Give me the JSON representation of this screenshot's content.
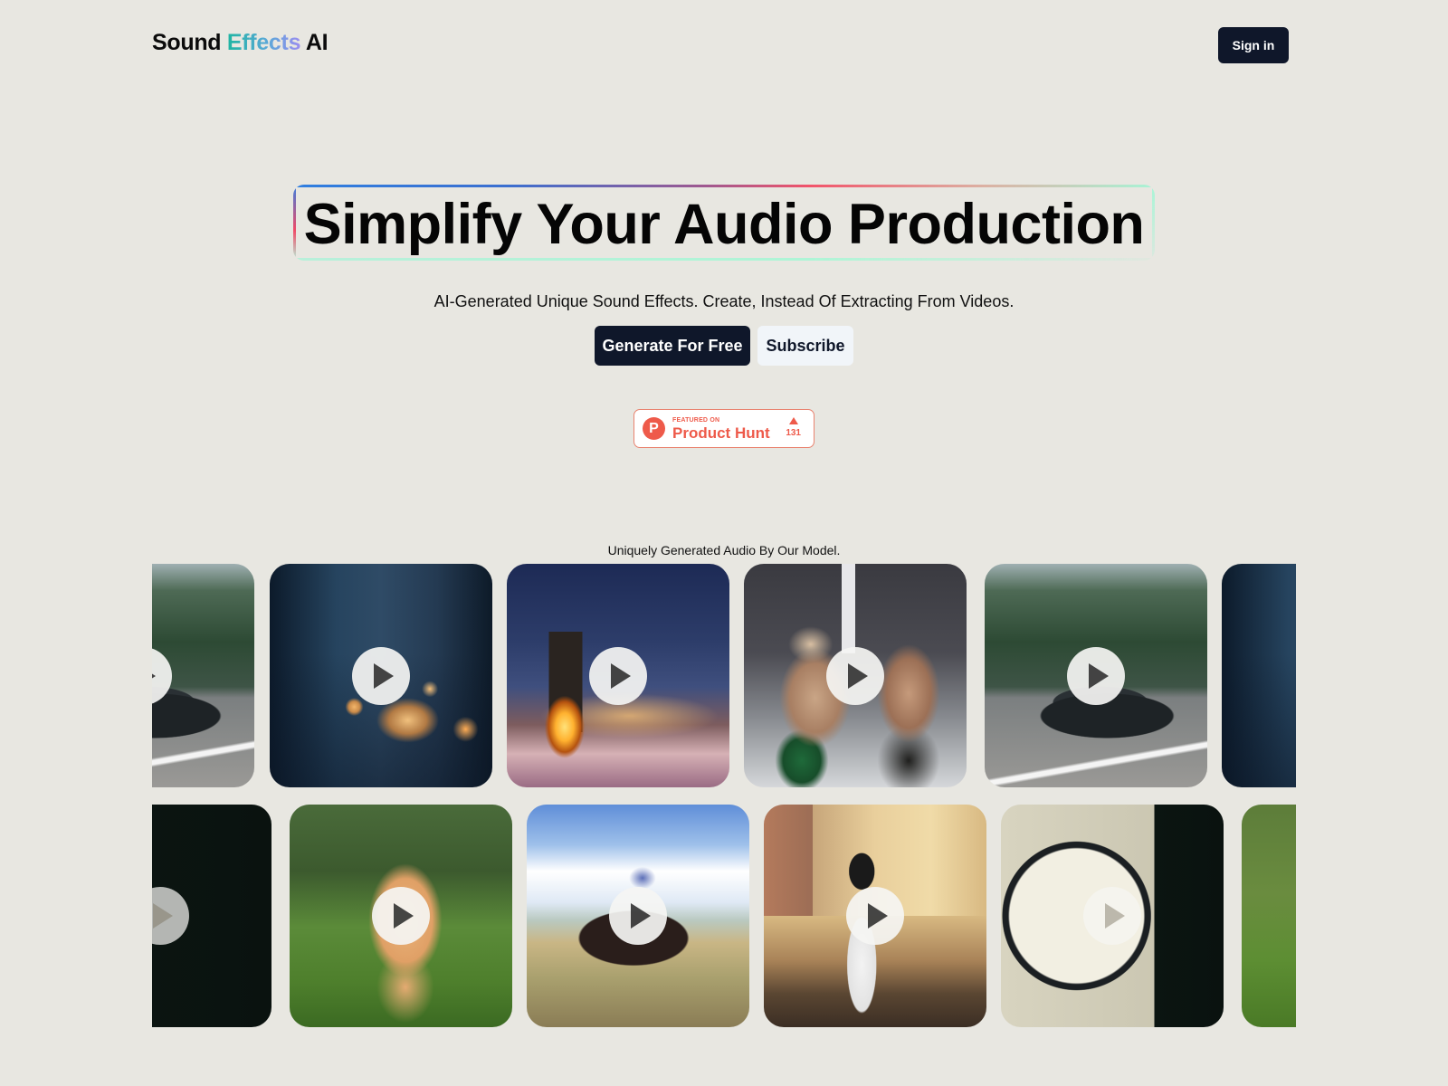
{
  "header": {
    "logo": {
      "part1": "Sound ",
      "part2": "Effects",
      "part3": " AI"
    },
    "signin_label": "Sign in"
  },
  "hero": {
    "headline": "Simplify Your Audio Production",
    "subtitle": "AI-Generated Unique Sound Effects. Create, Instead Of Extracting From Videos.",
    "primary_cta": "Generate For Free",
    "secondary_cta": "Subscribe"
  },
  "product_hunt": {
    "featured_label": "FEATURED ON",
    "name": "Product Hunt",
    "logo_letter": "P",
    "votes": "131",
    "color": "#EE5A4A"
  },
  "gallery": {
    "caption": "Uniquely Generated Audio By Our Model.",
    "row1": [
      {
        "scene": "car-forest-road",
        "partial": "left"
      },
      {
        "scene": "rainy-night-house"
      },
      {
        "scene": "fireplace-snowy-mountains"
      },
      {
        "scene": "mma-fight"
      },
      {
        "scene": "car-forest-road"
      },
      {
        "scene": "rainy-night-house",
        "partial": "right"
      }
    ],
    "row2": [
      {
        "scene": "wall-clock",
        "partial": "left"
      },
      {
        "scene": "kitten-grass"
      },
      {
        "scene": "horse-rider-splash"
      },
      {
        "scene": "restaurant-robot"
      },
      {
        "scene": "wall-clock"
      },
      {
        "scene": "kitten-grass",
        "partial": "right"
      }
    ]
  },
  "colors": {
    "background": "#E8E7E1",
    "primary_button": "#0F172A",
    "secondary_button": "#F1F5F9",
    "logo_gradient_start": "#1FB5A2",
    "logo_gradient_end": "#9A8DF0"
  }
}
